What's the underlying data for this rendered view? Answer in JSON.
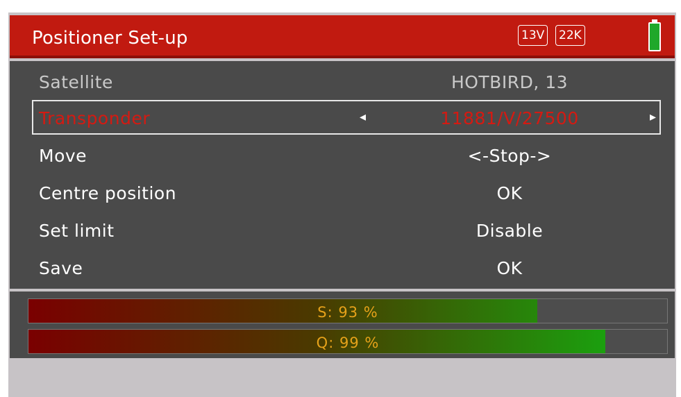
{
  "header": {
    "title": "Positioner Set-up",
    "badge_voltage": "13V",
    "badge_tone": "22K"
  },
  "menu": {
    "rows": [
      {
        "label": "Satellite",
        "value": "HOTBIRD, 13"
      },
      {
        "label": "Transponder",
        "value": "11881/V/27500"
      },
      {
        "label": "Move",
        "value": "<-Stop->"
      },
      {
        "label": "Centre position",
        "value": "OK"
      },
      {
        "label": "Set limit",
        "value": "Disable"
      },
      {
        "label": "Save",
        "value": "OK"
      }
    ]
  },
  "meters": {
    "signal": {
      "label": "S: 93 %",
      "percent": 93
    },
    "quality": {
      "label": "Q: 99 %",
      "percent": 99
    }
  },
  "colors": {
    "header_bg": "#c11a10",
    "selected_text": "#d41a12",
    "meter_text": "#e6a21a",
    "battery": "#1fa82a"
  }
}
